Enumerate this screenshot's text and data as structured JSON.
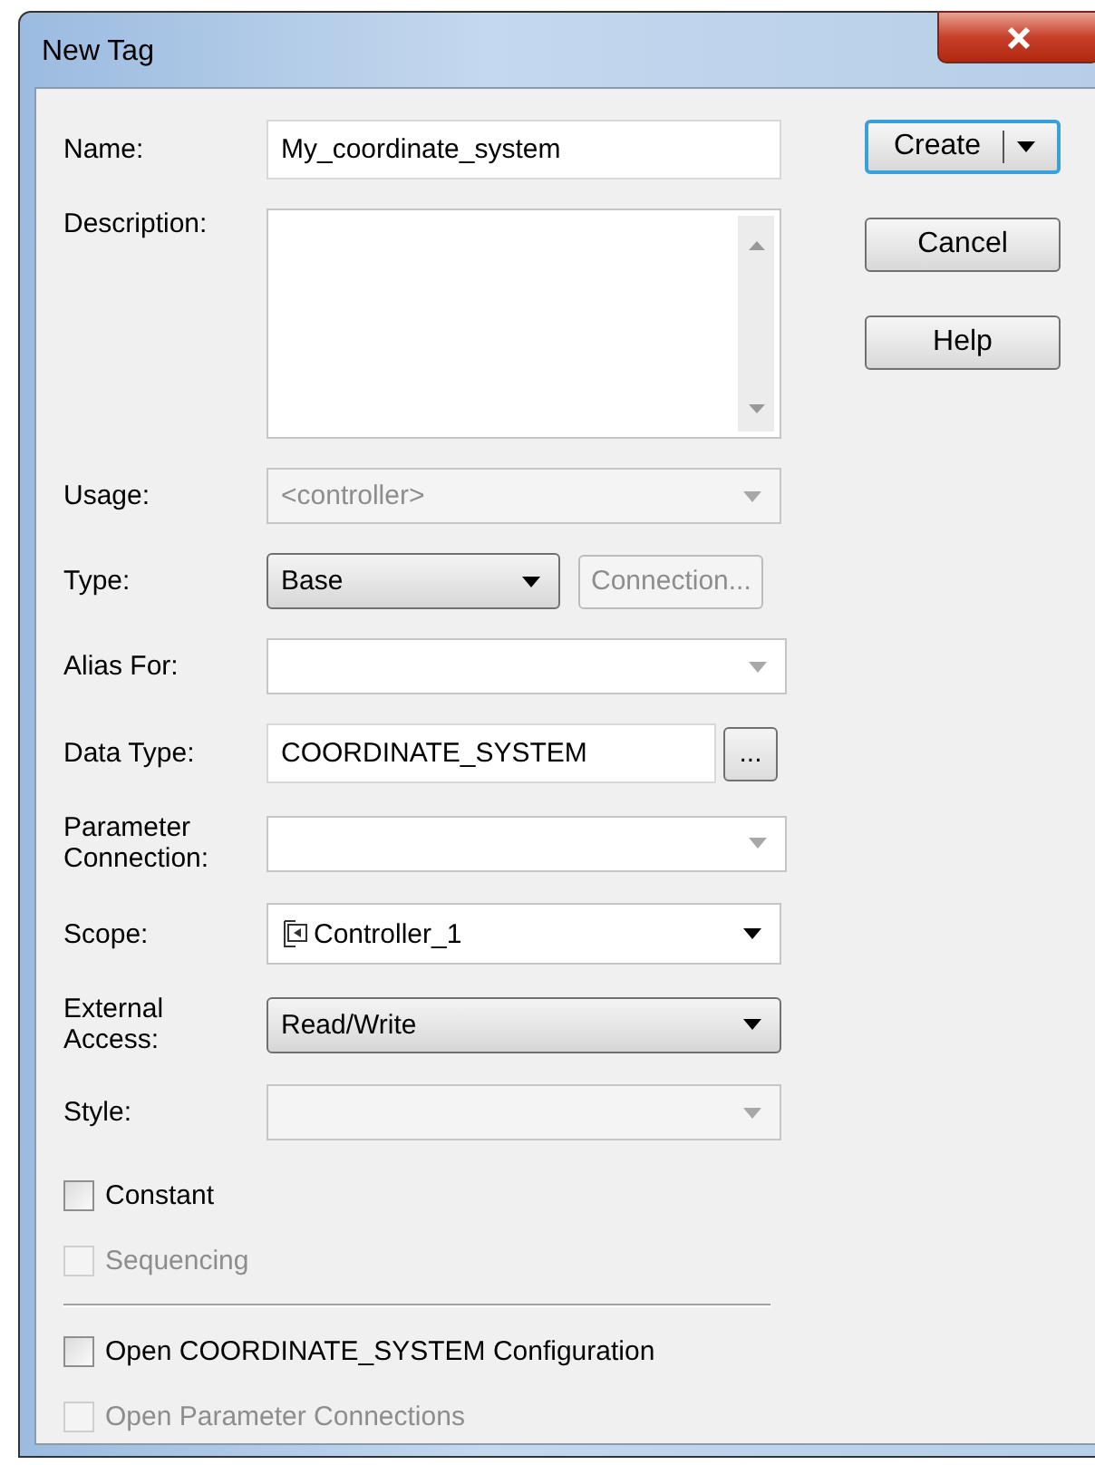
{
  "window": {
    "title": "New Tag"
  },
  "fields": [
    {
      "label": "Name:",
      "kind": "text",
      "value": "My_coordinate_system"
    },
    {
      "label": "Description:",
      "kind": "textarea"
    },
    {
      "label": "Usage:",
      "kind": "combo",
      "value": "<controller>",
      "disabled": true
    },
    {
      "label": "Type:",
      "kind": "dropdown",
      "value": "Base",
      "side_button": {
        "label": "Connection...",
        "disabled": true
      }
    },
    {
      "label": "Alias For:",
      "kind": "combo",
      "disabled": false
    },
    {
      "label": "Data Type:",
      "kind": "text",
      "value": "COORDINATE_SYSTEM",
      "side_button": {
        "label": "...",
        "disabled": false
      }
    },
    {
      "label": "Parameter Connection:",
      "kind": "combo",
      "disabled": false
    },
    {
      "label": "Scope:",
      "kind": "select",
      "value": "Controller_1"
    },
    {
      "label": "External Access:",
      "kind": "dropdown",
      "value": "Read/Write"
    },
    {
      "label": "Style:",
      "kind": "combo",
      "disabled": true
    }
  ],
  "checkboxes": [
    {
      "label": "Constant",
      "checked": false,
      "disabled": false
    },
    {
      "label": "Sequencing",
      "checked": false,
      "disabled": true
    }
  ],
  "options": [
    {
      "label": "Open COORDINATE_SYSTEM Configuration",
      "checked": false,
      "disabled": false
    },
    {
      "label": "Open Parameter Connections",
      "checked": false,
      "disabled": true
    }
  ],
  "buttons": [
    {
      "label": "Create",
      "kind": "split",
      "default": true
    },
    {
      "label": "Cancel",
      "kind": "plain",
      "default": false
    },
    {
      "label": "Help",
      "kind": "plain",
      "default": false
    }
  ]
}
